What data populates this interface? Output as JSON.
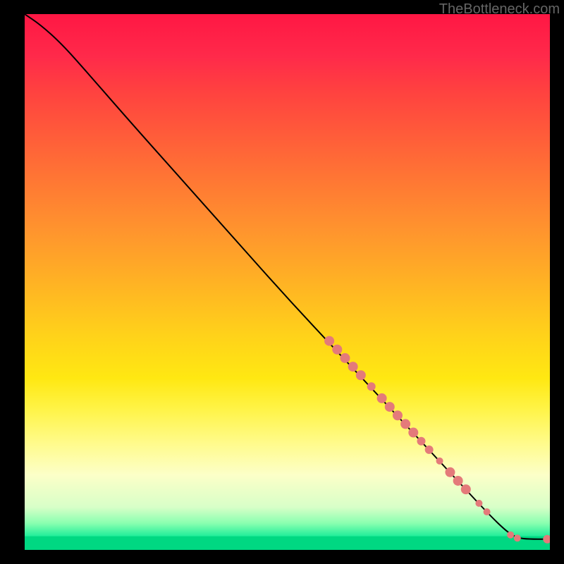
{
  "watermark": "TheBottleneck.com",
  "chart_data": {
    "type": "line",
    "title": "",
    "xlabel": "",
    "ylabel": "",
    "xlim": [
      0,
      100
    ],
    "ylim": [
      0,
      100
    ],
    "curve": [
      {
        "x": 0,
        "y": 100
      },
      {
        "x": 3,
        "y": 98
      },
      {
        "x": 7,
        "y": 94.5
      },
      {
        "x": 12,
        "y": 89
      },
      {
        "x": 20,
        "y": 80
      },
      {
        "x": 30,
        "y": 69
      },
      {
        "x": 40,
        "y": 58
      },
      {
        "x": 50,
        "y": 47
      },
      {
        "x": 60,
        "y": 36.5
      },
      {
        "x": 70,
        "y": 26
      },
      {
        "x": 80,
        "y": 15.5
      },
      {
        "x": 88,
        "y": 7
      },
      {
        "x": 92,
        "y": 3.2
      },
      {
        "x": 94,
        "y": 2.2
      },
      {
        "x": 96,
        "y": 2
      },
      {
        "x": 100,
        "y": 2
      }
    ],
    "points": [
      {
        "x": 58,
        "y": 39,
        "r": 7
      },
      {
        "x": 59.5,
        "y": 37.4,
        "r": 7
      },
      {
        "x": 61,
        "y": 35.8,
        "r": 7
      },
      {
        "x": 62.5,
        "y": 34.2,
        "r": 7
      },
      {
        "x": 64,
        "y": 32.6,
        "r": 7
      },
      {
        "x": 66,
        "y": 30.5,
        "r": 6
      },
      {
        "x": 68,
        "y": 28.3,
        "r": 7
      },
      {
        "x": 69.5,
        "y": 26.7,
        "r": 7
      },
      {
        "x": 71,
        "y": 25.1,
        "r": 7
      },
      {
        "x": 72.5,
        "y": 23.5,
        "r": 7
      },
      {
        "x": 74,
        "y": 21.9,
        "r": 7
      },
      {
        "x": 75.5,
        "y": 20.3,
        "r": 6
      },
      {
        "x": 77,
        "y": 18.7,
        "r": 6
      },
      {
        "x": 79,
        "y": 16.6,
        "r": 5
      },
      {
        "x": 81,
        "y": 14.5,
        "r": 7
      },
      {
        "x": 82.5,
        "y": 12.9,
        "r": 7
      },
      {
        "x": 84,
        "y": 11.3,
        "r": 7
      },
      {
        "x": 86.5,
        "y": 8.7,
        "r": 5
      },
      {
        "x": 88,
        "y": 7.1,
        "r": 5
      },
      {
        "x": 92.5,
        "y": 2.8,
        "r": 5
      },
      {
        "x": 93.8,
        "y": 2.2,
        "r": 5
      },
      {
        "x": 99.5,
        "y": 2,
        "r": 6
      }
    ],
    "gradient_stops": [
      {
        "pos": 0,
        "color": "#ff1744"
      },
      {
        "pos": 50,
        "color": "#ffd21a"
      },
      {
        "pos": 85,
        "color": "#fcffc8"
      },
      {
        "pos": 97.5,
        "color": "#00d882"
      },
      {
        "pos": 100,
        "color": "#00d882"
      }
    ]
  }
}
